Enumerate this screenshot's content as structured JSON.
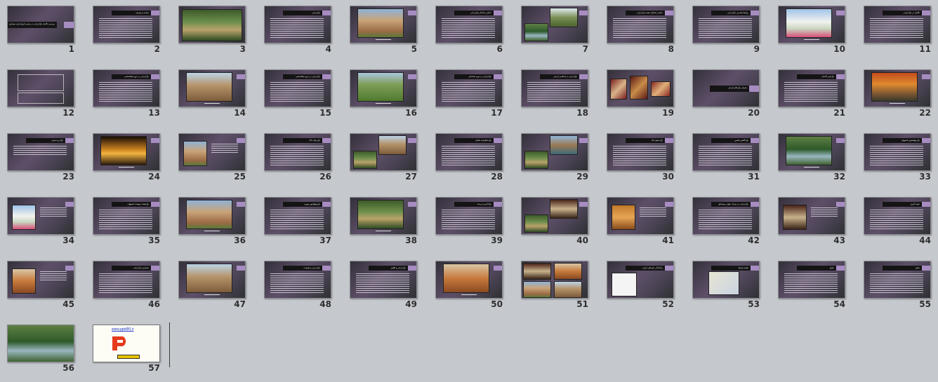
{
  "app": {
    "view": "Slide Sorter"
  },
  "slides": [
    {
      "num": "1",
      "layout": "title",
      "title": "بررسی تکامل باغ ایرانی در مسیر تاریخ ایران معماری"
    },
    {
      "num": "2",
      "layout": "text",
      "title": "مقدمه و تعریف"
    },
    {
      "num": "3",
      "layout": "photo",
      "scene": "garden-path"
    },
    {
      "num": "4",
      "layout": "text",
      "title": "باغ ایرانی"
    },
    {
      "num": "5",
      "layout": "photo-top",
      "scene": "pavilion"
    },
    {
      "num": "6",
      "layout": "text",
      "title": "عناصر ساختار باغ ایرانی"
    },
    {
      "num": "7",
      "layout": "two-photo",
      "scene": "palms"
    },
    {
      "num": "8",
      "layout": "text",
      "title": "عناصر تشکیل دهنده باغ ایرانی"
    },
    {
      "num": "9",
      "layout": "text",
      "title": "روابط هندسی باغ ایرانی"
    },
    {
      "num": "10",
      "layout": "photo-top",
      "scene": "white-palace"
    },
    {
      "num": "11",
      "layout": "text",
      "title": "تکامل در باغ ایرانی"
    },
    {
      "num": "12",
      "layout": "boxes"
    },
    {
      "num": "13",
      "layout": "text",
      "title": "باغ ایرانی در دوره هخامنشی"
    },
    {
      "num": "14",
      "layout": "photo-top",
      "scene": "ruins"
    },
    {
      "num": "15",
      "layout": "text",
      "title": "باغ ایرانی در دوره هخامنشی"
    },
    {
      "num": "16",
      "layout": "photo-top",
      "scene": "field"
    },
    {
      "num": "17",
      "layout": "text",
      "title": "باغ ایرانی در دوره ساسانی"
    },
    {
      "num": "18",
      "layout": "text",
      "title": "باغ ایرانی در اسلامی ایرانی"
    },
    {
      "num": "19",
      "layout": "carpets"
    },
    {
      "num": "20",
      "layout": "section",
      "title": "معرفی باغ های ایرانی"
    },
    {
      "num": "21",
      "layout": "text",
      "title": "باغ فین کاشان"
    },
    {
      "num": "22",
      "layout": "photo-top",
      "scene": "autumn"
    },
    {
      "num": "23",
      "layout": "text-short",
      "title": "باغ ارم شیراز"
    },
    {
      "num": "24",
      "layout": "photo-top",
      "scene": "night"
    },
    {
      "num": "25",
      "layout": "photo-left",
      "scene": "pavilion"
    },
    {
      "num": "26",
      "layout": "text",
      "title": "باغ دولت آباد"
    },
    {
      "num": "27",
      "layout": "two-photo",
      "scene": "ruins"
    },
    {
      "num": "28",
      "layout": "text",
      "title": "باغ شاهزاده ماهان"
    },
    {
      "num": "29",
      "layout": "two-photo",
      "scene": "pool"
    },
    {
      "num": "30",
      "layout": "text",
      "title": "باغ عفیف آباد"
    },
    {
      "num": "31",
      "layout": "text",
      "title": "باغ گلشن طبس"
    },
    {
      "num": "32",
      "layout": "photo-top",
      "scene": "cypress"
    },
    {
      "num": "33",
      "layout": "text",
      "title": "باغ چهلستون اصفهان"
    },
    {
      "num": "34",
      "layout": "photo-left",
      "scene": "white-palace"
    },
    {
      "num": "35",
      "layout": "text",
      "title": "باغ هشت بهشت اصفهان"
    },
    {
      "num": "36",
      "layout": "photo-top",
      "scene": "pavilion"
    },
    {
      "num": "37",
      "layout": "text",
      "title": "باغ پهلوانپور مهریز"
    },
    {
      "num": "38",
      "layout": "photo-top",
      "scene": "garden-path"
    },
    {
      "num": "39",
      "layout": "text",
      "title": "باغ اکبریه بیرجند"
    },
    {
      "num": "40",
      "layout": "two-photo",
      "scene": "arch"
    },
    {
      "num": "41",
      "layout": "photo-left",
      "scene": "interior"
    },
    {
      "num": "42",
      "layout": "text",
      "title": "باغ ایرانی در میراث جهانی یونسکو"
    },
    {
      "num": "43",
      "layout": "photo-left",
      "scene": "arch"
    },
    {
      "num": "44",
      "layout": "text",
      "title": "نتیجه گیری"
    },
    {
      "num": "45",
      "layout": "photo-left",
      "scene": "desert"
    },
    {
      "num": "46",
      "layout": "text",
      "title": "معماری باغ ایرانی"
    },
    {
      "num": "47",
      "layout": "photo-top",
      "scene": "ruins"
    },
    {
      "num": "48",
      "layout": "text",
      "title": "باغ ایرانی و طبیعت"
    },
    {
      "num": "49",
      "layout": "text",
      "title": "باغ ایرانی و اقلیم"
    },
    {
      "num": "50",
      "layout": "photo-top",
      "scene": "desert"
    },
    {
      "num": "51",
      "layout": "collage"
    },
    {
      "num": "52",
      "layout": "map-slide",
      "title": "پراکندگی باغ های ایرانی"
    },
    {
      "num": "53",
      "layout": "map2",
      "title": "نقشه باغ ها"
    },
    {
      "num": "54",
      "layout": "text",
      "title": "منابع"
    },
    {
      "num": "55",
      "layout": "text",
      "title": "منابع"
    },
    {
      "num": "56",
      "layout": "photo-full",
      "scene": "cypress"
    },
    {
      "num": "57",
      "layout": "promo",
      "link": "www.pptd90.ir"
    }
  ]
}
